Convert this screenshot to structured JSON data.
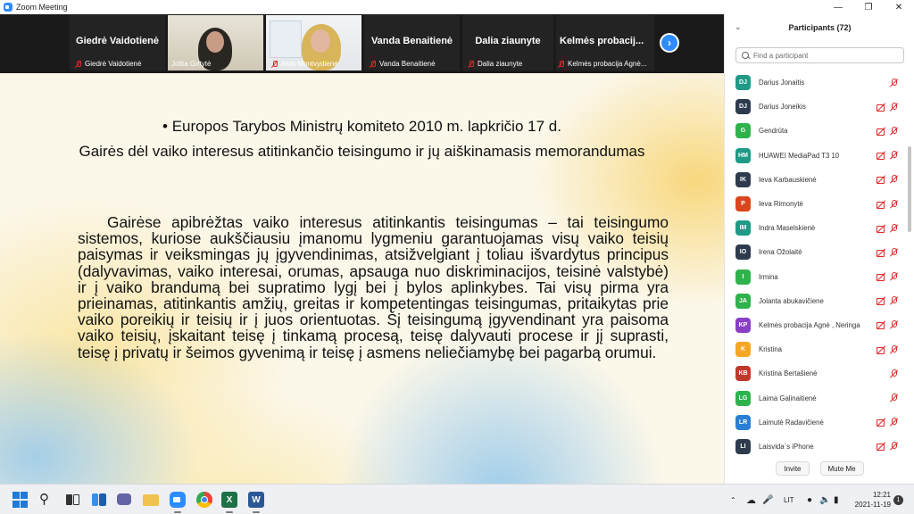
{
  "window": {
    "title": "Zoom Meeting",
    "icon": "zoom-icon"
  },
  "gallery": {
    "tiles": [
      {
        "name_big": "Giedrė Vaidotienė",
        "name_small": "Giedrė Vaidotienė",
        "video": false
      },
      {
        "name_big": "",
        "name_small": "Jolita Gritytė",
        "video": true
      },
      {
        "name_big": "",
        "name_small": "Asta Montvydienė",
        "video": true
      },
      {
        "name_big": "Vanda Benaitienė",
        "name_small": "Vanda Benaitienė",
        "video": false
      },
      {
        "name_big": "Dalia ziaunyte",
        "name_small": "Dalia ziaunyte",
        "video": false
      },
      {
        "name_big": "Kelmės probacij...",
        "name_small": "Kelmės probacija Agnė...",
        "video": false
      }
    ],
    "next_icon": "chevron-right-icon"
  },
  "slide": {
    "bullet": "• Europos Tarybos Ministrų komiteto 2010 m. lapkričio 17 d.",
    "subtitle": "Gairės dėl vaiko interesus atitinkančio teisingumo ir jų aiškinamasis memorandumas",
    "body": "Gairėse apibrėžtas vaiko interesus atitinkantis teisingumas – tai teisingumo sistemos, kuriose aukščiausiu įmanomu lygmeniu garantuojamas visų vaiko teisių paisymas ir veiksmingas jų įgyvendinimas, atsižvelgiant į toliau išvardytus principus (dalyvavimas, vaiko interesai, orumas, apsauga nuo diskriminacijos, teisinė valstybė) ir į vaiko brandumą bei supratimo lygį bei į bylos aplinkybes. Tai visų pirma yra prieinamas, atitinkantis amžių, greitas ir kompetentingas teisingumas, pritaikytas prie vaiko poreikių ir teisių ir į juos orientuotas. Šį teisingumą įgyvendinant yra paisoma vaiko teisių, įskaitant teisę į tinkamą procesą, teisę dalyvauti procese ir jį suprasti, teisę į privatų ir šeimos gyvenimą ir teisę į asmens neliečiamybę bei pagarbą orumui."
  },
  "participants": {
    "title": "Participants (72)",
    "search_placeholder": "Find a participant",
    "invite_label": "Invite",
    "mute_label": "Mute Me",
    "list": [
      {
        "initials": "DJ",
        "name": "Darius Jonaitis",
        "color": "#1f9a86",
        "cam_off": false
      },
      {
        "initials": "DJ",
        "name": "Darius Joneikis",
        "color": "#2e3b4e",
        "cam_off": true
      },
      {
        "initials": "G",
        "name": "Gendrūta",
        "color": "#2fb24c",
        "cam_off": true
      },
      {
        "initials": "HM",
        "name": "HUAWEI MediaPad T3 10",
        "color": "#1f9a86",
        "cam_off": true
      },
      {
        "initials": "IK",
        "name": "Ieva Karbauskienė",
        "color": "#2e3b4e",
        "cam_off": true
      },
      {
        "initials": "P",
        "name": "Ieva Rimonytė",
        "color": "#d9461e",
        "cam_off": true
      },
      {
        "initials": "IM",
        "name": "Indra Maselskienė",
        "color": "#1f9a86",
        "cam_off": true
      },
      {
        "initials": "IO",
        "name": "Irena Ožolaitė",
        "color": "#2e3b4e",
        "cam_off": true
      },
      {
        "initials": "I",
        "name": "Irmina",
        "color": "#2fb24c",
        "cam_off": true
      },
      {
        "initials": "JA",
        "name": "Jolanta abukavičiene",
        "color": "#2fb24c",
        "cam_off": true
      },
      {
        "initials": "KP",
        "name": "Kelmės probacija Agnė , Neringa",
        "color": "#8a3fc4",
        "cam_off": true
      },
      {
        "initials": "K",
        "name": "Kristina",
        "color": "#f5a623",
        "cam_off": true
      },
      {
        "initials": "KB",
        "name": "Kristina Bertašienė",
        "color": "#c0392b",
        "cam_off": false
      },
      {
        "initials": "LG",
        "name": "Laima Galinaitienė",
        "color": "#2fb24c",
        "cam_off": false
      },
      {
        "initials": "LR",
        "name": "Laimutė Radavičienė",
        "color": "#2a7fd4",
        "cam_off": true
      },
      {
        "initials": "LI",
        "name": "Laisvida`s iPhone",
        "color": "#2e3b4e",
        "cam_off": true
      }
    ]
  },
  "taskbar": {
    "apps": [
      "windows-start-icon",
      "search-icon",
      "task-view-icon",
      "widgets-icon",
      "teams-chat-icon",
      "file-explorer-icon",
      "zoom-icon",
      "chrome-icon",
      "excel-icon",
      "word-icon"
    ],
    "tray_language": "LIT",
    "time": "12:21",
    "date": "2021-11-19",
    "notifications": "1"
  }
}
